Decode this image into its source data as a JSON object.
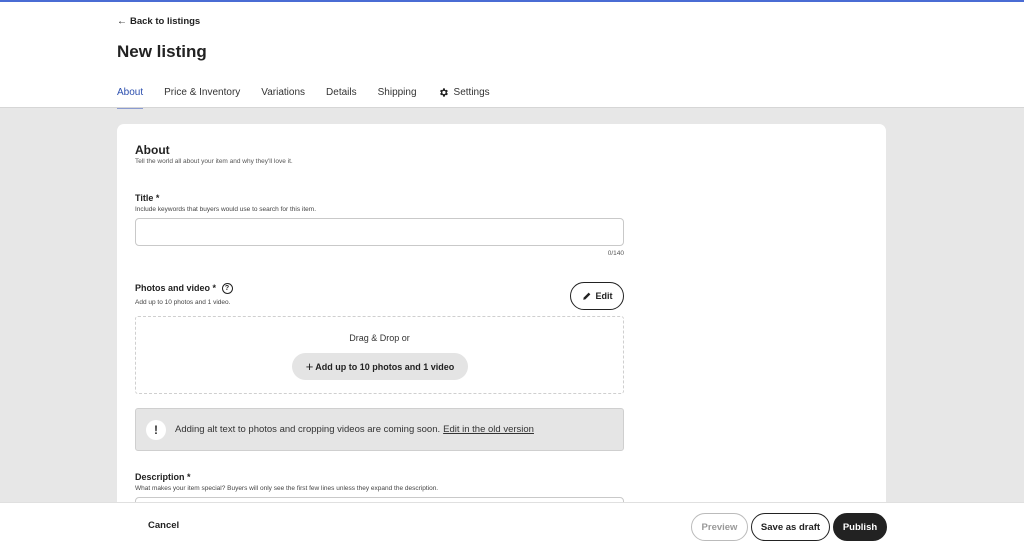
{
  "header": {
    "back_link": "Back to listings",
    "back_icon": "arrow-left-icon",
    "page_title": "New listing",
    "tabs": [
      {
        "label": "About",
        "active": true
      },
      {
        "label": "Price & Inventory"
      },
      {
        "label": "Variations"
      },
      {
        "label": "Details"
      },
      {
        "label": "Shipping"
      },
      {
        "label": "Settings",
        "icon": "gear-icon"
      }
    ]
  },
  "about": {
    "title": "About",
    "subtitle": "Tell the world all about your item and why they'll love it."
  },
  "title_field": {
    "label": "Title",
    "required_mark": "*",
    "help": "Include keywords that buyers would use to search for this item.",
    "value": "",
    "char_count": "0/140"
  },
  "photos": {
    "label": "Photos and video",
    "required_mark": "*",
    "help_icon": "?",
    "help": "Add up to 10 photos and 1 video.",
    "edit_label": "Edit",
    "drop_text": "Drag & Drop or",
    "add_button_label": "Add up to 10 photos and 1 video",
    "add_icon": "+"
  },
  "notice": {
    "icon": "!",
    "text": "Adding alt text to photos and cropping videos are coming soon.",
    "link": "Edit in the old version"
  },
  "description": {
    "label": "Description",
    "required_mark": "*",
    "help": "What makes your item special? Buyers will only see the first few lines unless they expand the description."
  },
  "footer": {
    "cancel": "Cancel",
    "preview": "Preview",
    "save_draft": "Save as draft",
    "publish": "Publish"
  },
  "colors": {
    "accent": "#2c4fae",
    "top_bar": "#4a6cd4",
    "primary_button": "#222222",
    "page_background": "#e7e7e7"
  }
}
